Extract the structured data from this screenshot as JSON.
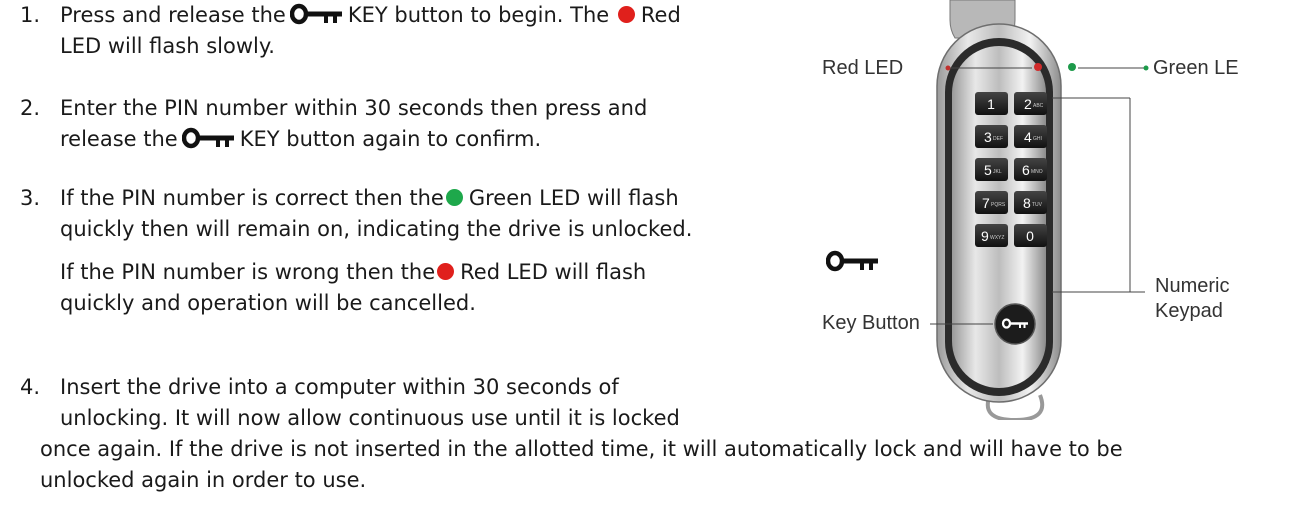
{
  "steps": [
    {
      "num": "1.",
      "parts": [
        "Press and release the",
        "KEY button to begin. The",
        "Red",
        "LED will flash slowly."
      ]
    },
    {
      "num": "2.",
      "line1": "Enter the PIN number within 30 seconds then press and",
      "line2a": "release the",
      "line2b": "KEY button again to confirm."
    },
    {
      "num": "3.",
      "line1a": "If the PIN number is correct then the",
      "line1b": "Green LED will flash",
      "line2": "quickly then will remain on, indicating the drive is unlocked.",
      "line3a": "If the PIN number is wrong then the",
      "line3b": "Red LED will flash",
      "line4": "quickly and operation will be cancelled."
    },
    {
      "num": "4.",
      "line1": "Insert the drive into a computer within 30 seconds of",
      "line2": "unlocking.  It will now allow continuous use until it is locked",
      "line3": "once again. If the drive is not inserted in the allotted time, it will automatically lock and will have to be",
      "line4": "unlocked again in order to use."
    }
  ],
  "callouts": {
    "red_led": "Red LED",
    "green_led": "Green LE",
    "numeric": "Numeric",
    "keypad": "Keypad",
    "key_button": "Key Button"
  },
  "keys": [
    {
      "digit": "1",
      "letters": ""
    },
    {
      "digit": "2",
      "letters": "ABC"
    },
    {
      "digit": "3",
      "letters": "DEF"
    },
    {
      "digit": "4",
      "letters": "GHI"
    },
    {
      "digit": "5",
      "letters": "JKL"
    },
    {
      "digit": "6",
      "letters": "MNO"
    },
    {
      "digit": "7",
      "letters": "PQRS"
    },
    {
      "digit": "8",
      "letters": "TUV"
    },
    {
      "digit": "9",
      "letters": "WXYZ"
    },
    {
      "digit": "0",
      "letters": ""
    }
  ],
  "colors": {
    "red_led": "#e0201c",
    "green_led": "#1ea84b",
    "bezel": "#2b2b2b",
    "key": "#1f1f1f"
  },
  "icons": {
    "key": "key-icon"
  }
}
